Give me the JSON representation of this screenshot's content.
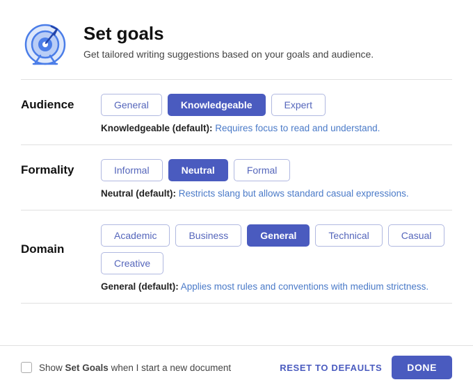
{
  "header": {
    "title": "Set goals",
    "subtitle": "Get tailored writing suggestions based on your goals and audience."
  },
  "audience": {
    "label": "Audience",
    "options": [
      "General",
      "Knowledgeable",
      "Expert"
    ],
    "active": "Knowledgeable",
    "description_strong": "Knowledgeable (default):",
    "description_text": " Requires focus to read and understand."
  },
  "formality": {
    "label": "Formality",
    "options": [
      "Informal",
      "Neutral",
      "Formal"
    ],
    "active": "Neutral",
    "description_strong": "Neutral (default):",
    "description_text": " Restricts slang but allows standard casual expressions."
  },
  "domain": {
    "label": "Domain",
    "options": [
      "Academic",
      "Business",
      "General",
      "Technical",
      "Casual",
      "Creative"
    ],
    "active": "General",
    "description_strong": "General (default):",
    "description_text": " Applies most rules and conventions with medium strictness."
  },
  "footer": {
    "checkbox_label_pre": "Show ",
    "checkbox_label_bold": "Set Goals",
    "checkbox_label_post": " when I start a new document",
    "reset_label": "RESET TO DEFAULTS",
    "done_label": "DONE"
  }
}
